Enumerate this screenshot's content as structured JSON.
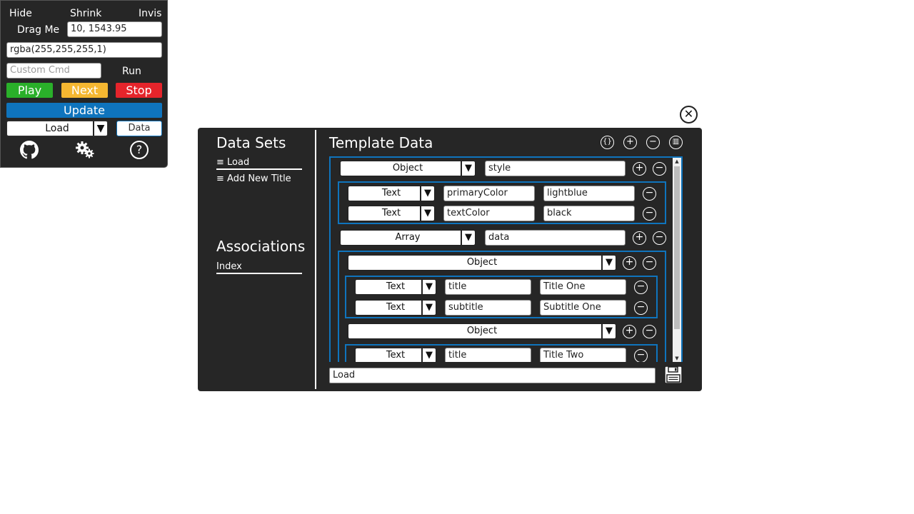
{
  "panel": {
    "hide": "Hide",
    "shrink": "Shrink",
    "invis": "Invis",
    "drag_me": "Drag Me",
    "position_value": "10, 1543.95",
    "color_value": "rgba(255,255,255,1)",
    "custom_cmd_placeholder": "Custom Cmd",
    "run": "Run",
    "play": "Play",
    "next": "Next",
    "stop": "Stop",
    "update": "Update",
    "load_select": "Load",
    "data_button": "Data"
  },
  "sidebar": {
    "data_sets_title": "Data Sets",
    "items": [
      {
        "label": "≡ Load"
      },
      {
        "label": "≡ Add New Title"
      }
    ],
    "associations_title": "Associations",
    "assoc_items": [
      {
        "label": "Index"
      }
    ]
  },
  "template": {
    "title": "Template Data",
    "rows": {
      "style_type": "Object",
      "style_key": "style",
      "pc_type": "Text",
      "pc_key": "primaryColor",
      "pc_value": "lightblue",
      "tc_type": "Text",
      "tc_key": "textColor",
      "tc_value": "black",
      "data_type": "Array",
      "data_key": "data",
      "obj1_type": "Object",
      "t1_type": "Text",
      "t1_key": "title",
      "t1_value": "Title One",
      "s1_type": "Text",
      "s1_key": "subtitle",
      "s1_value": "Subtitle One",
      "obj2_type": "Object",
      "t2_type": "Text",
      "t2_key": "title",
      "t2_value": "Title Two"
    },
    "load_value": "Load"
  },
  "colors": {
    "panel_bg": "#262626",
    "accent_blue": "#0f74bd",
    "play_green": "#2ab02a",
    "next_yellow": "#f5b731",
    "stop_red": "#e5242b"
  }
}
